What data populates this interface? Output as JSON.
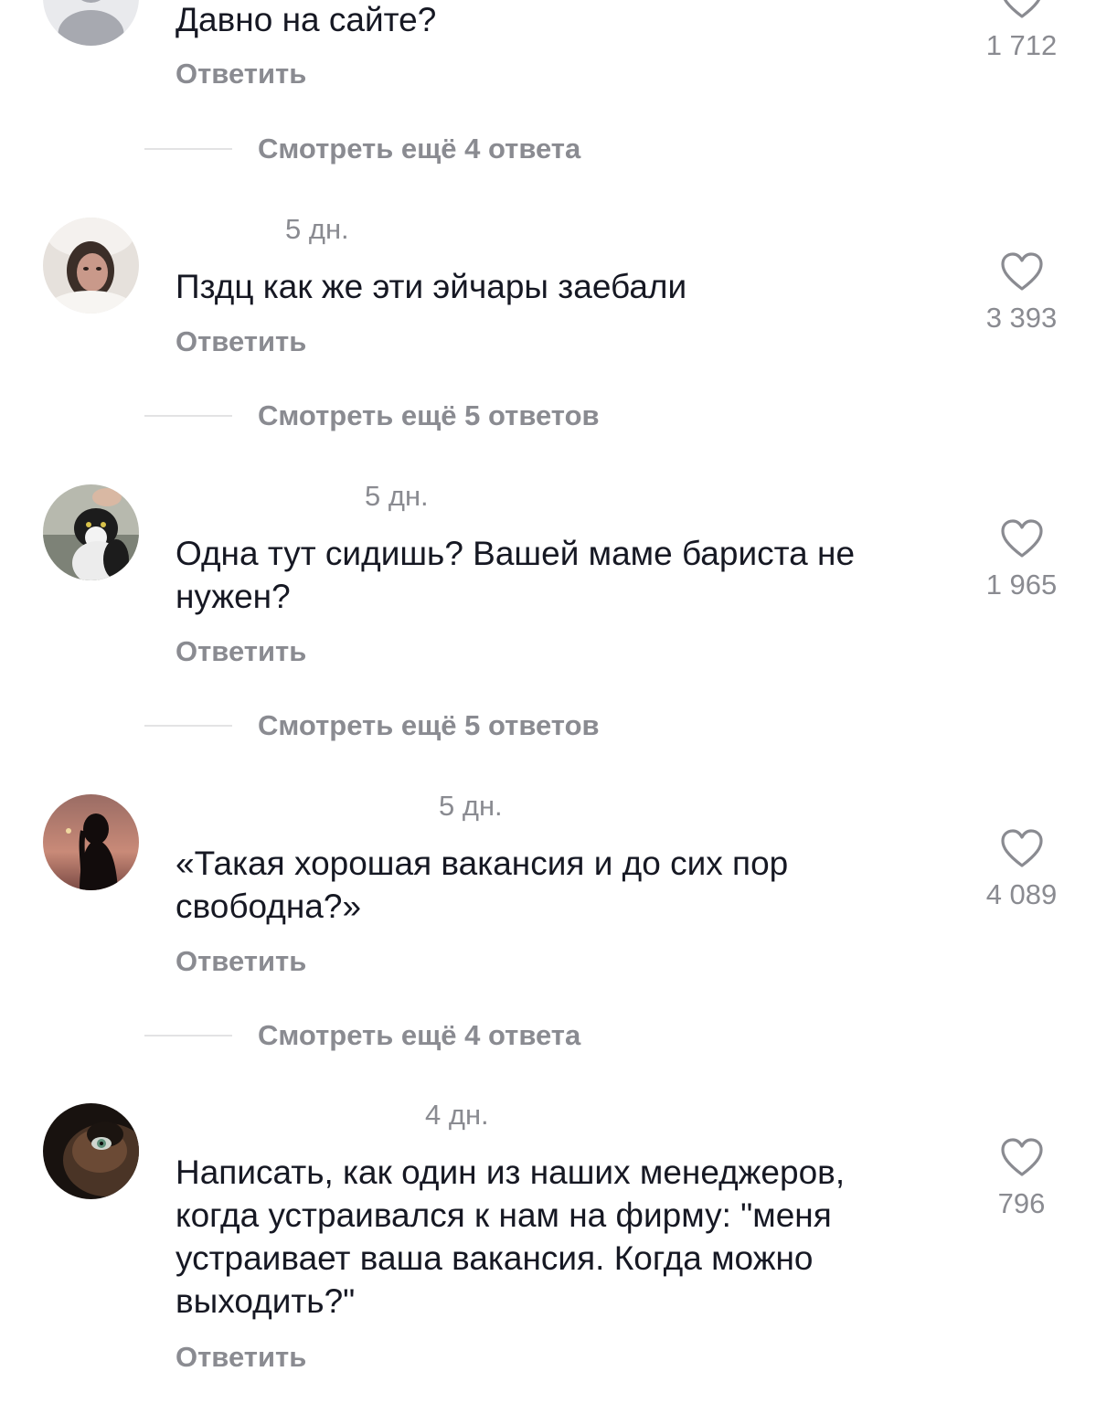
{
  "comments": [
    {
      "time": "",
      "text": "Давно на сайте?",
      "reply_label": "Ответить",
      "likes": "1 712"
    },
    {
      "time": "5 дн.",
      "text": "Пздц как же эти эйчары заебали",
      "reply_label": "Ответить",
      "likes": "3 393"
    },
    {
      "time": "5 дн.",
      "text": "Одна тут сидишь? Вашей маме бариста не нужен?",
      "reply_label": "Ответить",
      "likes": "1 965"
    },
    {
      "time": "5 дн.",
      "text": "«Такая хорошая вакансия и до сих пор свободна?»",
      "reply_label": "Ответить",
      "likes": "4 089"
    },
    {
      "time": "4 дн.",
      "text": "Написать, как один из наших менеджеров, когда устраивался к нам на фирму: \"меня устраивает ваша вакансия. Когда можно выходить?\"",
      "reply_label": "Ответить",
      "likes": "796"
    }
  ],
  "view_more": [
    "Смотреть ещё 4 ответа",
    "Смотреть ещё 5 ответов",
    "Смотреть ещё 5 ответов",
    "Смотреть ещё 4 ответа"
  ],
  "colors": {
    "text": "#161823",
    "secondary": "#8a8b91",
    "divider": "#e3e3e4"
  },
  "icons": {
    "like": "heart-outline-icon",
    "avatar": "user-avatar"
  }
}
